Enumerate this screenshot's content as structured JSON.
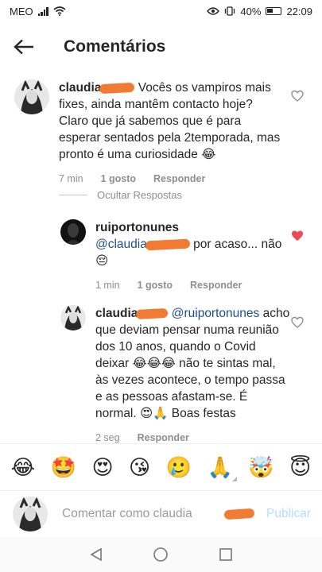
{
  "status_bar": {
    "carrier": "MEO",
    "battery": "40%",
    "time": "22:09"
  },
  "header": {
    "title": "Comentários"
  },
  "comments": [
    {
      "username": "claudia",
      "text": "Vocês os vampiros mais fixes, ainda mantêm contacto hoje? Claro que já sabemos que é para esperar sentados pela 2temporada, mas pronto é uma curiosidade 😂",
      "time": "7 min",
      "likes": "1 gosto",
      "reply": "Responder"
    }
  ],
  "hide_replies": "Ocultar Respostas",
  "replies": [
    {
      "username": "ruiportonunes",
      "mention": "@claudia",
      "text": "por acaso... não 😔",
      "time": "1 min",
      "likes": "1 gosto",
      "reply": "Responder"
    },
    {
      "username": "claudia",
      "mention": "@ruiportonunes",
      "text": "acho que deviam pensar numa reunião dos 10 anos, quando o Covid deixar 😂😂😂 não te sintas mal, às vezes acontece, o tempo passa e as pessoas afastam-se. É normal. 😍🙏 Boas festas",
      "time": "2 seg",
      "reply": "Responder"
    }
  ],
  "emojis": [
    "😂",
    "🤩",
    "😍",
    "😘",
    "🥲",
    "🙏",
    "🤯",
    "😇"
  ],
  "composer": {
    "placeholder": "Comentar como claudia",
    "publish": "Publicar"
  },
  "colors": {
    "liked_heart": "#ed4956",
    "publish_disabled": "#b2dffc",
    "redaction": "#f27b33"
  }
}
